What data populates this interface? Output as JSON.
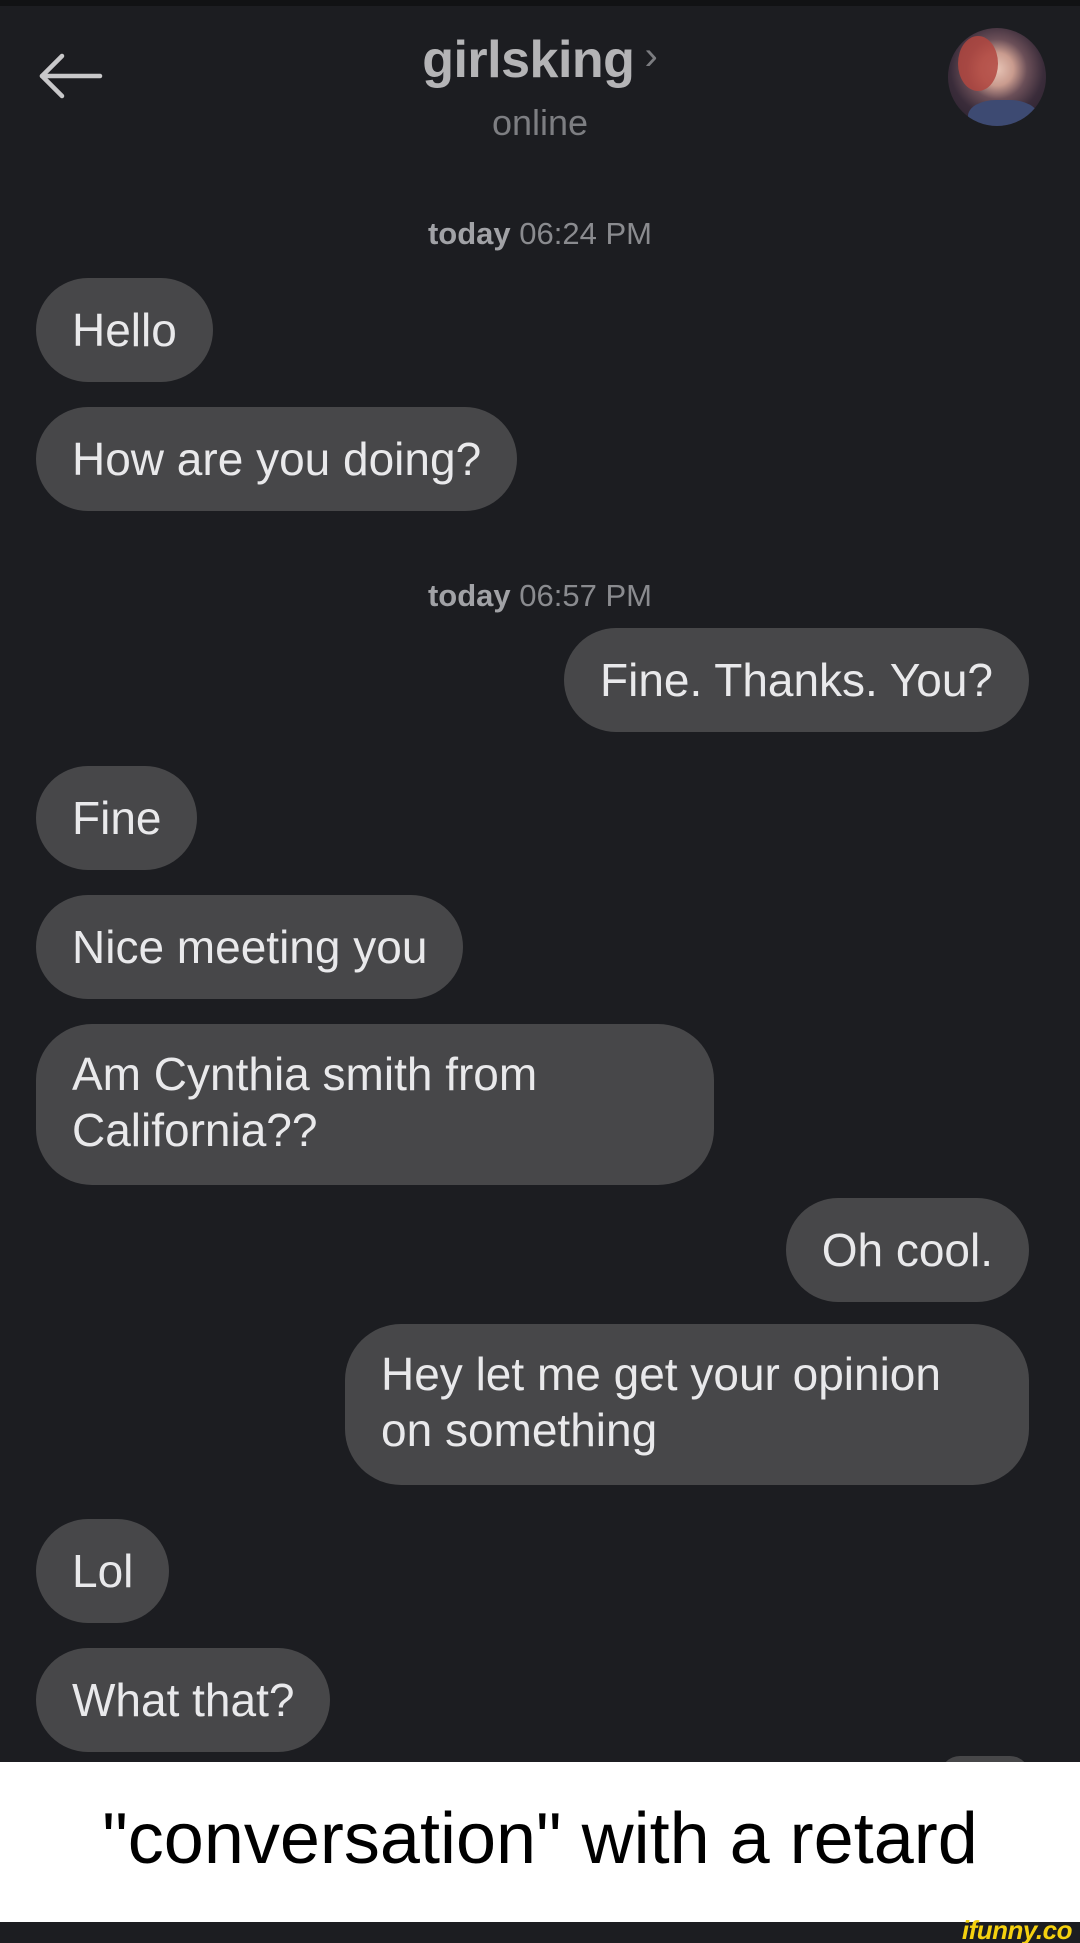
{
  "header": {
    "contact_name": "girlsking",
    "status": "online"
  },
  "icons": {
    "back": "arrow-left-icon",
    "chevron": "chevron-right-icon",
    "avatar": "profile-photo"
  },
  "messages": [
    {
      "type": "timestamp",
      "day": "today",
      "time": "06:24 PM"
    },
    {
      "type": "bubble",
      "direction": "incoming",
      "text": "Hello"
    },
    {
      "type": "bubble",
      "direction": "incoming",
      "text": "How are you doing?"
    },
    {
      "type": "timestamp",
      "day": "today",
      "time": "06:57 PM"
    },
    {
      "type": "bubble",
      "direction": "outgoing",
      "text": "Fine. Thanks. You?"
    },
    {
      "type": "bubble",
      "direction": "incoming",
      "text": "Fine"
    },
    {
      "type": "bubble",
      "direction": "incoming",
      "text": "Nice meeting you"
    },
    {
      "type": "bubble",
      "direction": "incoming",
      "text": "Am Cynthia smith from California??"
    },
    {
      "type": "bubble",
      "direction": "outgoing",
      "text": "Oh cool."
    },
    {
      "type": "bubble",
      "direction": "outgoing",
      "text": "Hey let me get your opinion on something"
    },
    {
      "type": "bubble",
      "direction": "incoming",
      "text": "Lol"
    },
    {
      "type": "bubble",
      "direction": "incoming",
      "text": "What that?"
    }
  ],
  "caption": "\"conversation\" with a retard",
  "watermark": "ifunny.co",
  "colors": {
    "background": "#1c1d21",
    "bubble": "#474749",
    "bubble_text": "#e9e9eb",
    "caption_background": "#ffffff",
    "watermark": "#f5d10f"
  }
}
